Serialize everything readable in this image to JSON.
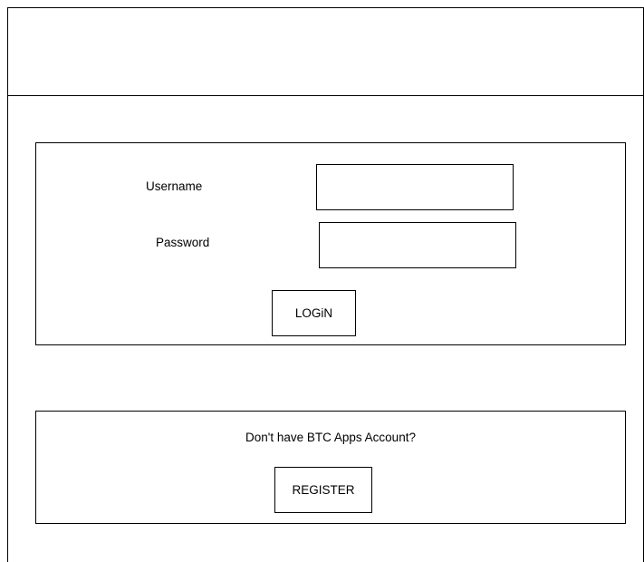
{
  "login": {
    "username_label": "Username",
    "password_label": "Password",
    "username_value": "",
    "password_value": "",
    "login_label": "LOGiN"
  },
  "register": {
    "prompt": "Don't have BTC Apps Account?",
    "register_label": "REGISTER"
  }
}
